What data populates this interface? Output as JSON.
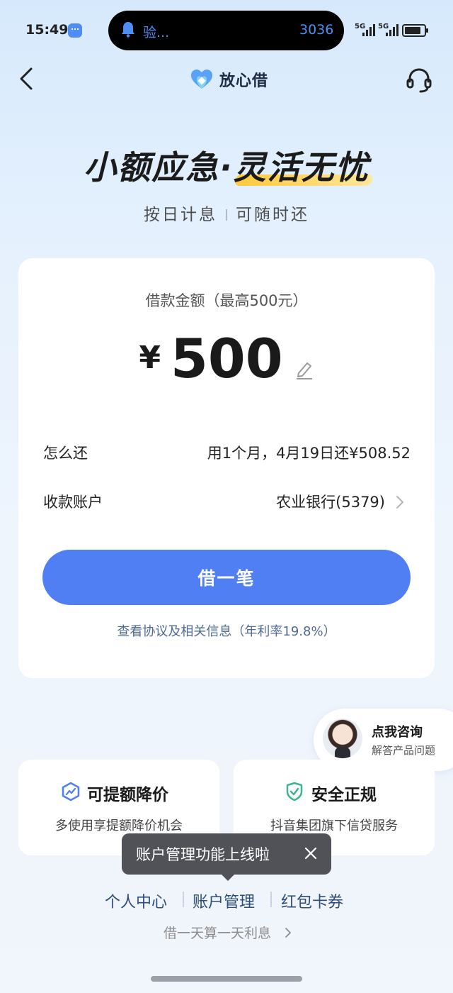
{
  "status_bar": {
    "time": "15:49",
    "island_text": "验...",
    "island_code": "3036",
    "signal_1": "5G",
    "signal_2": "5G"
  },
  "header": {
    "brand": "放心借"
  },
  "hero": {
    "title_main": "小额应急·",
    "title_highlight": "灵活无忧",
    "subtitle_left": "按日计息",
    "subtitle_right": "可随时还"
  },
  "loan": {
    "amount_label": "借款金额（最高500元）",
    "currency": "¥",
    "amount": "500",
    "repay_label": "怎么还",
    "repay_value": "用1个月，4月19日还¥508.52",
    "account_label": "收款账户",
    "account_value": "农业银行(5379)",
    "borrow_button": "借一笔",
    "agreement_link": "查看协议及相关信息（年利率19.8%）"
  },
  "consult": {
    "title": "点我咨询",
    "subtitle": "解答产品问题"
  },
  "features": [
    {
      "title": "可提额降价",
      "desc": "多使用享提额降价机会"
    },
    {
      "title": "安全正规",
      "desc": "抖音集团旗下信贷服务"
    }
  ],
  "tooltip": {
    "text": "账户管理功能上线啦"
  },
  "footer": {
    "links": [
      "个人中心",
      "账户管理",
      "红包卡券"
    ],
    "daily_interest": "借一天算一天利息"
  },
  "colors": {
    "primary": "#4f7ff2",
    "highlight": "#ffc83a",
    "link": "#2d4d7a"
  }
}
